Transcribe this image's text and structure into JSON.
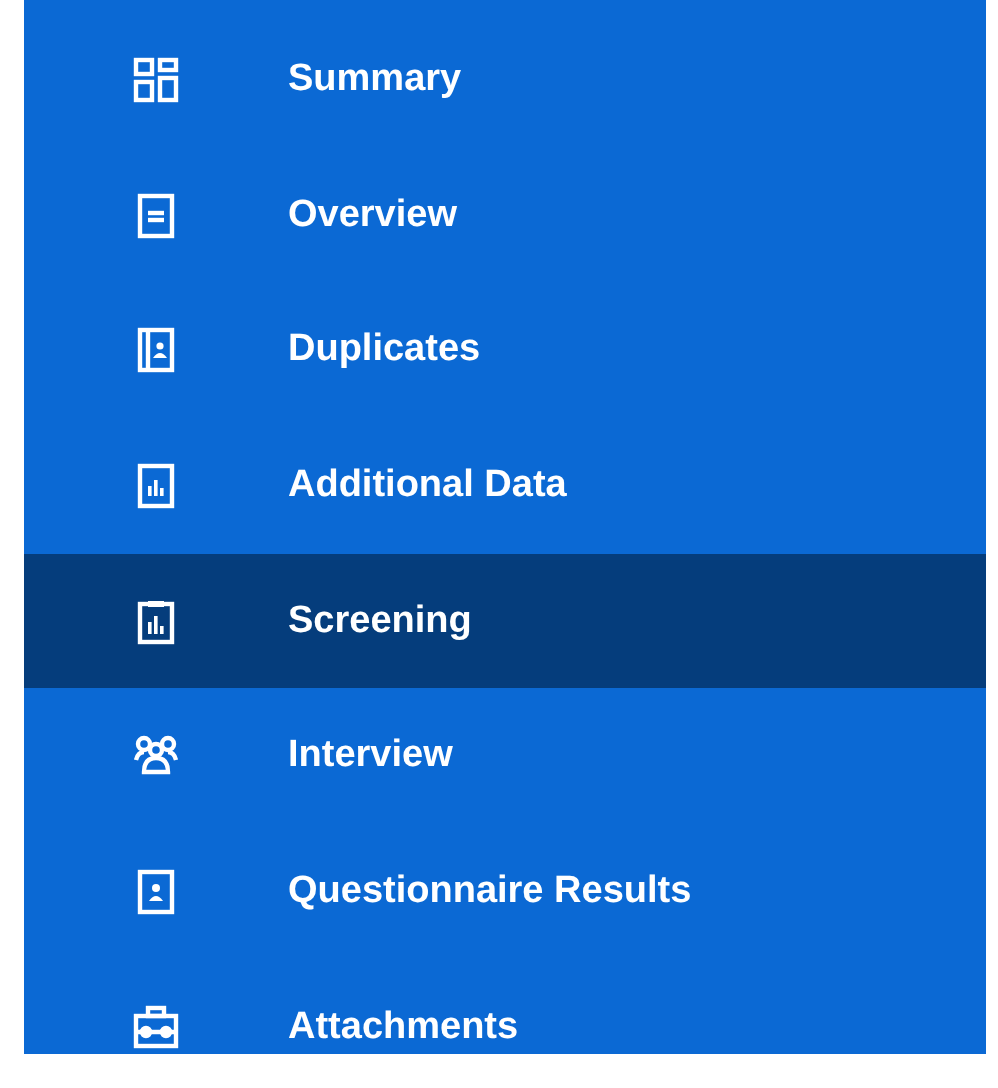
{
  "menu": {
    "items": [
      {
        "label": "Summary",
        "selected": false
      },
      {
        "label": "Overview",
        "selected": false
      },
      {
        "label": "Duplicates",
        "selected": false
      },
      {
        "label": "Additional Data",
        "selected": false
      },
      {
        "label": "Screening",
        "selected": true
      },
      {
        "label": "Interview",
        "selected": false
      },
      {
        "label": "Questionnaire Results",
        "selected": false
      },
      {
        "label": "Attachments",
        "selected": false
      }
    ]
  }
}
